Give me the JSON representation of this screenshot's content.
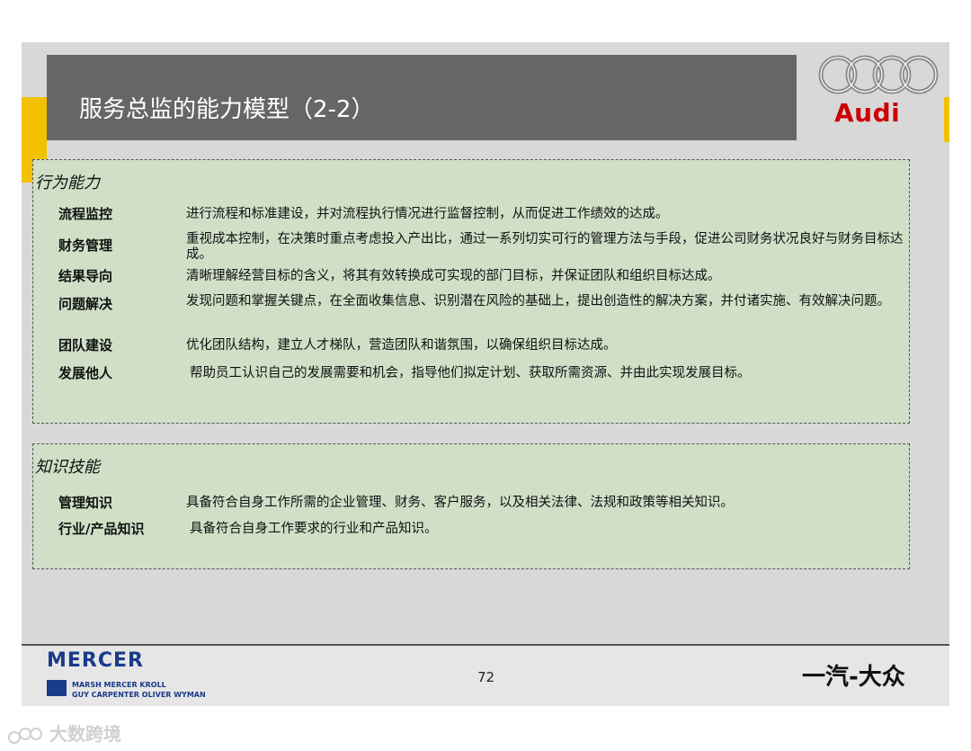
{
  "header": {
    "title": "服务总监的能力模型（2-2）"
  },
  "logos": {
    "audi": "Audi",
    "mercer": "MERCER",
    "mercer_sub_1": "MARSH  MERCER  KROLL",
    "mercer_sub_2": "GUY CARPENTER  OLIVER WYMAN",
    "faw": "一汽-大众"
  },
  "sections": [
    {
      "title": "行为能力",
      "rows": [
        {
          "label": "流程监控",
          "desc": "进行流程和标准建设，并对流程执行情况进行监督控制，从而促进工作绩效的达成。"
        },
        {
          "label": "财务管理",
          "desc": "重视成本控制，在决策时重点考虑投入产出比，通过一系列切实可行的管理方法与手段，促进公司财务状况良好与财务目标达成。"
        },
        {
          "label": "结果导向",
          "desc": "清晰理解经营目标的含义，将其有效转换成可实现的部门目标，并保证团队和组织目标达成。"
        },
        {
          "label": "问题解决",
          "desc": "发现问题和掌握关键点，在全面收集信息、识别潜在风险的基础上，提出创造性的解决方案，并付诸实施、有效解决问题。"
        },
        {
          "label": "团队建设",
          "desc": "优化团队结构，建立人才梯队，营造团队和谐氛围，以确保组织目标达成。"
        },
        {
          "label": "发展他人",
          "desc": "帮助员工认识自己的发展需要和机会，指导他们拟定计划、获取所需资源、并由此实现发展目标。"
        }
      ]
    },
    {
      "title": "知识技能",
      "rows": [
        {
          "label": "管理知识",
          "desc": "具备符合自身工作所需的企业管理、财务、客户服务，以及相关法律、法规和政策等相关知识。"
        },
        {
          "label": "行业/产品知识",
          "desc": "具备符合自身工作要求的行业和产品知识。"
        }
      ]
    }
  ],
  "footer": {
    "page_number": "72"
  },
  "watermark": {
    "text": "大数跨境"
  }
}
